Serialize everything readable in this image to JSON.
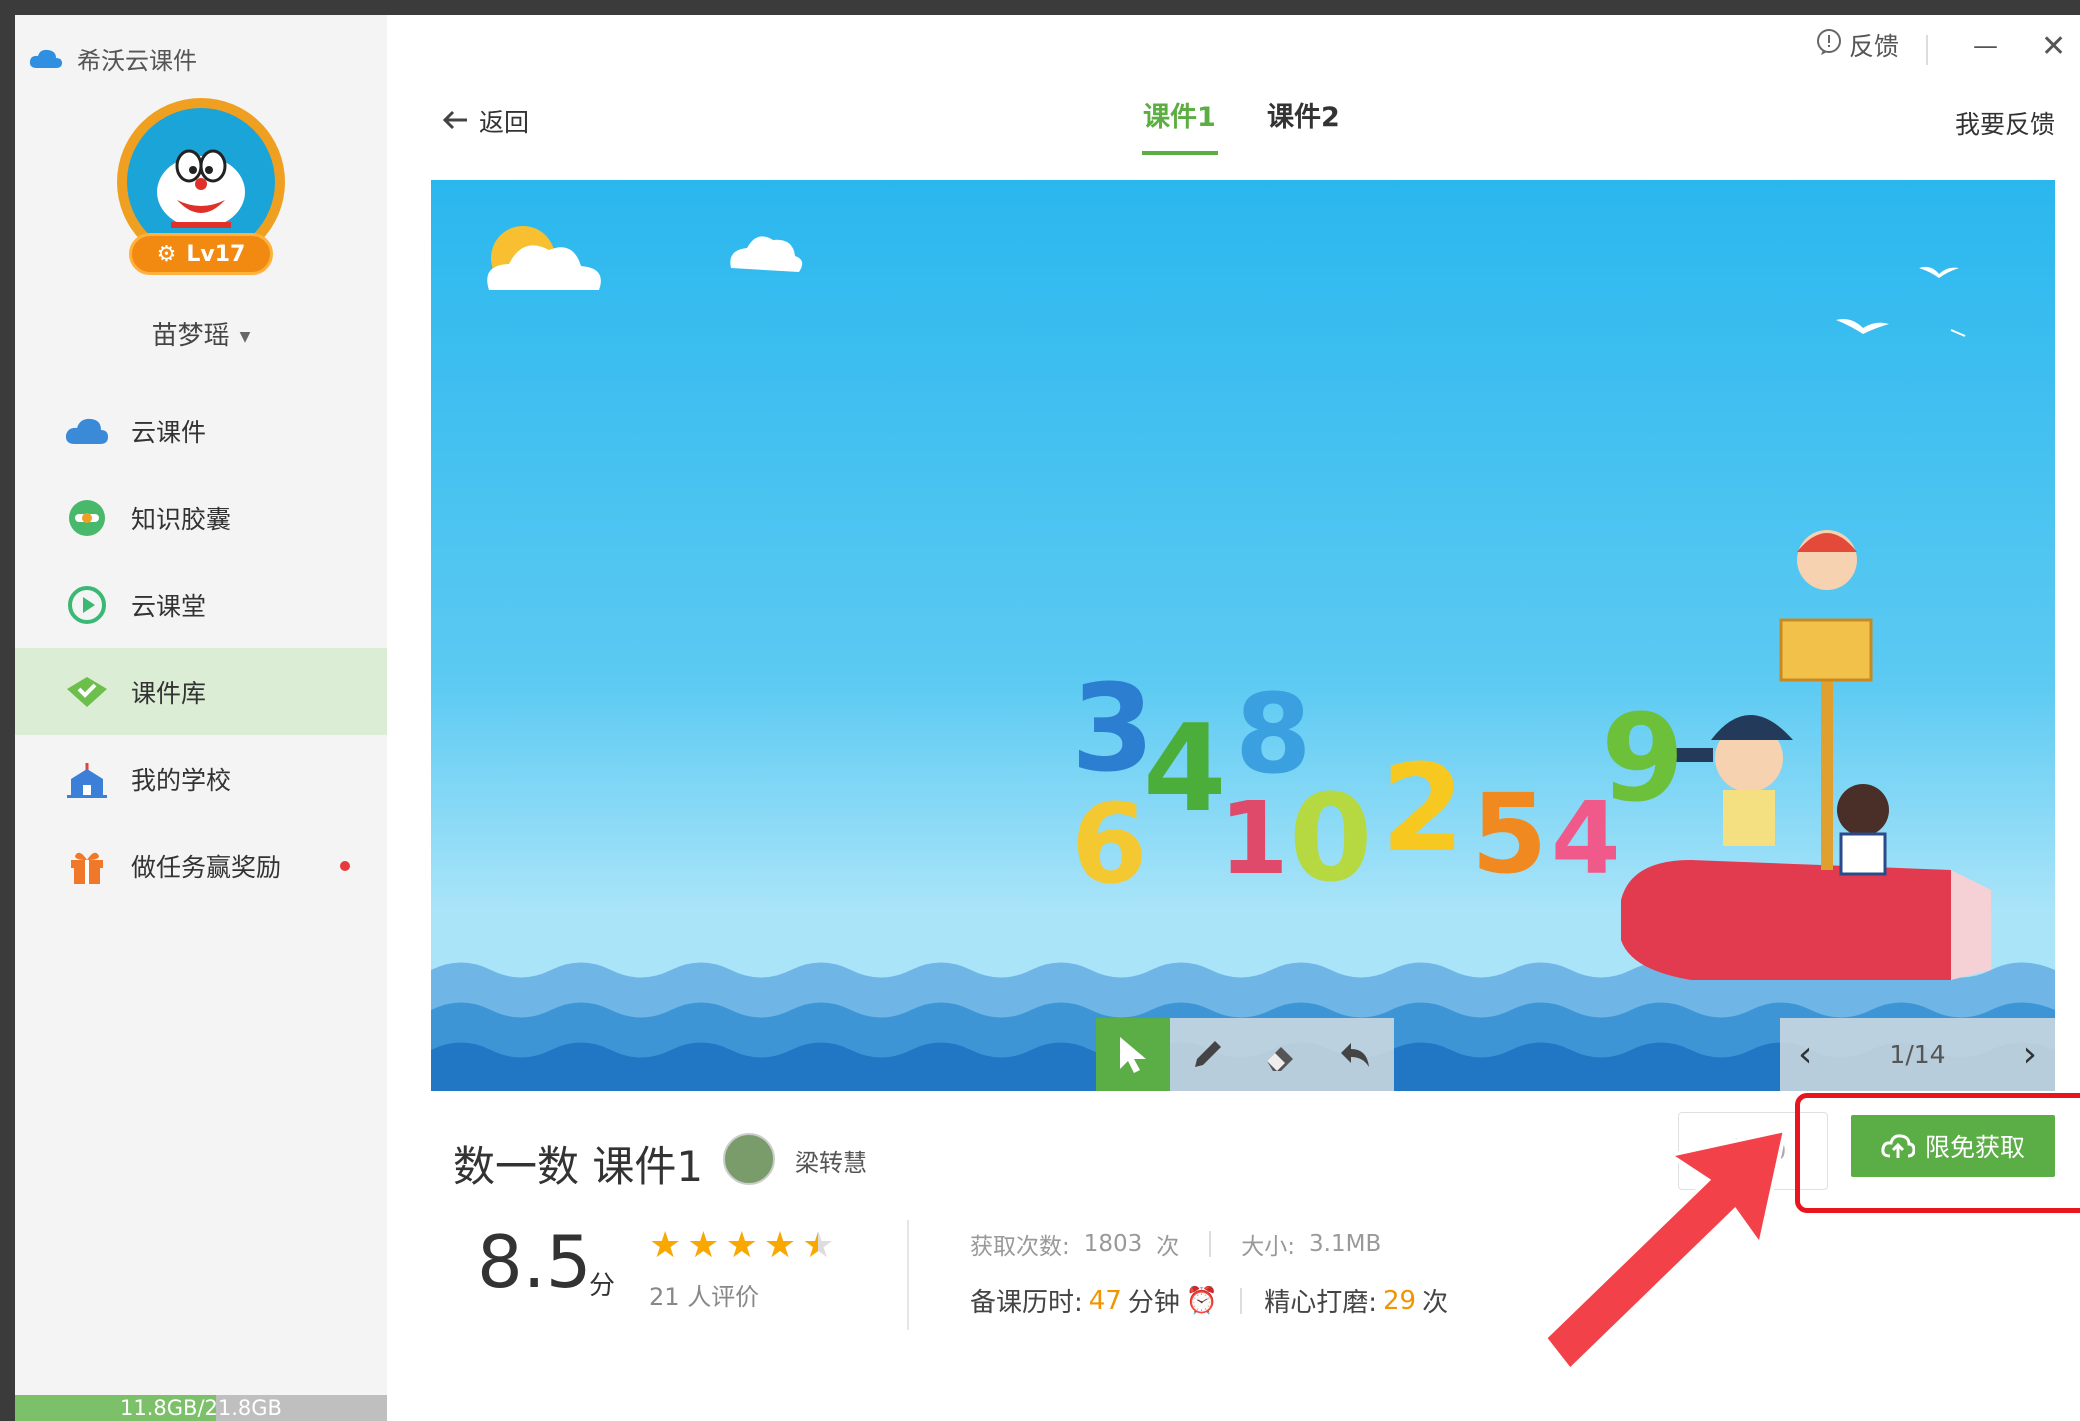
{
  "app": {
    "title": "希沃云课件"
  },
  "window": {
    "feedback_label": "反馈",
    "minimize_label": "—",
    "close_label": "✕"
  },
  "user": {
    "name": "苗梦瑶",
    "level": "Lv17"
  },
  "sidebar": {
    "items": [
      {
        "label": "云课件",
        "icon": "cloud-icon"
      },
      {
        "label": "知识胶囊",
        "icon": "capsule-icon"
      },
      {
        "label": "云课堂",
        "icon": "play-circle-icon"
      },
      {
        "label": "课件库",
        "icon": "library-icon",
        "active": true
      },
      {
        "label": "我的学校",
        "icon": "school-icon"
      },
      {
        "label": "做任务赢奖励",
        "icon": "gift-icon",
        "badge": "red-dot"
      }
    ],
    "storage": {
      "text": "11.8GB/21.8GB",
      "used_fraction": 0.54
    }
  },
  "header": {
    "back_label": "返回",
    "tabs": [
      {
        "label": "课件1",
        "active": true
      },
      {
        "label": "课件2",
        "active": false
      }
    ],
    "feedback_link": "我要反馈"
  },
  "slide": {
    "page": "1/14",
    "numbers": [
      "3",
      "4",
      "8",
      "6",
      "1",
      "0",
      "2",
      "5",
      "4",
      "9"
    ]
  },
  "courseware": {
    "title": "数一数 课件1",
    "author": "梁转慧",
    "likes": "60",
    "get_button": "限免获取",
    "score": "8.5",
    "score_unit": "分",
    "stars": 4.5,
    "raters_count": "21",
    "raters_label": "人评价",
    "downloads_label": "获取次数:",
    "downloads_value": "1803",
    "downloads_unit": "次",
    "size_label": "大小:",
    "size_value": "3.1MB",
    "prep_label": "备课历时:",
    "prep_value": "47",
    "prep_unit": "分钟",
    "polish_label": "精心打磨:",
    "polish_value": "29",
    "polish_unit": "次"
  },
  "colors": {
    "accent": "#5bad45",
    "highlight": "#e8141e",
    "orange": "#f29400"
  }
}
